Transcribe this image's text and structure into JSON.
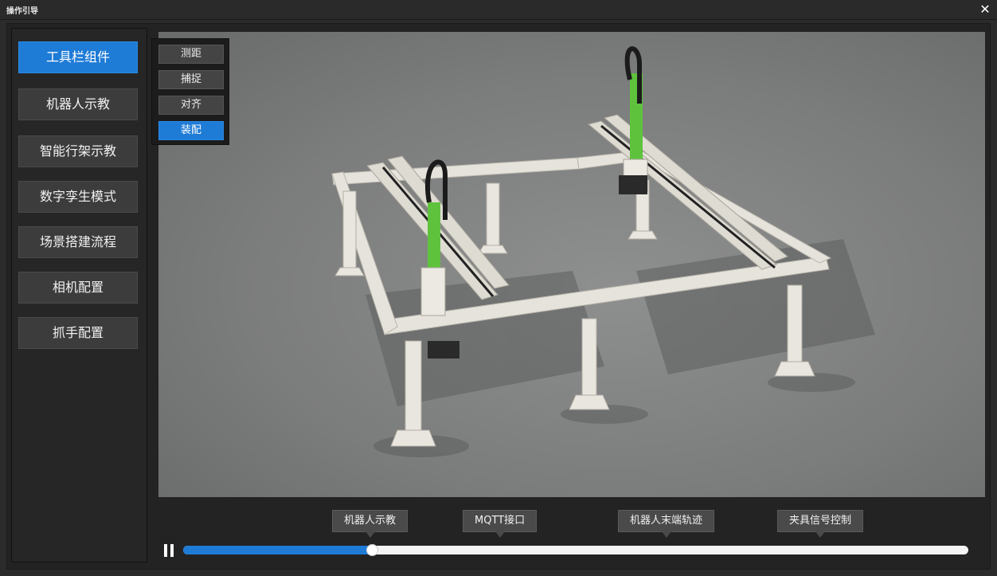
{
  "window": {
    "title": "操作引导",
    "close_icon": "close-icon",
    "close_glyph": "✕"
  },
  "sidebar": {
    "items": [
      {
        "label": "工具栏组件",
        "active": true
      },
      {
        "label": "机器人示教",
        "active": false
      },
      {
        "label": "智能行架示教",
        "active": false
      },
      {
        "label": "数字孪生模式",
        "active": false
      },
      {
        "label": "场景搭建流程",
        "active": false
      },
      {
        "label": "相机配置",
        "active": false
      },
      {
        "label": "抓手配置",
        "active": false
      }
    ]
  },
  "submenu": {
    "items": [
      {
        "label": "测距",
        "active": false
      },
      {
        "label": "捕捉",
        "active": false
      },
      {
        "label": "对齐",
        "active": false
      },
      {
        "label": "装配",
        "active": true
      }
    ]
  },
  "timeline": {
    "markers": [
      {
        "label": "机器人示教"
      },
      {
        "label": "MQTT接口"
      },
      {
        "label": "机器人末端轨迹"
      },
      {
        "label": "夹具信号控制"
      }
    ],
    "progress_fraction": 0.24,
    "play_state": "paused",
    "pause_icon": "pause-icon"
  },
  "colors": {
    "accent": "#1e7bd6",
    "background": "#2b2b2b",
    "robot_green": "#5fc23d"
  }
}
